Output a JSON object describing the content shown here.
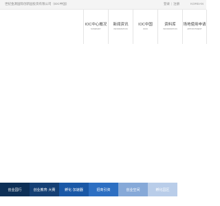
{
  "header": {
    "site_title": "世纪金源国际创新园投资有限公司（IDC中国）",
    "links": [
      "登录",
      "注册"
    ],
    "lang": "KOREAN"
  },
  "nav": [
    {
      "cn": "IOC中心概况",
      "en": "SUMMARY"
    },
    {
      "cn": "新闻资讯",
      "en": "INFORMATION"
    },
    {
      "cn": "IOC中国",
      "en": "IOCK"
    },
    {
      "cn": "资料库",
      "en": "INFORMATION"
    },
    {
      "cn": "场地使用申请",
      "en": "APPOINTMENT"
    }
  ],
  "tabs": [
    {
      "label": "创业园行",
      "color": "#0d2f56"
    },
    {
      "label": "创业教育·大赛",
      "color": "#153f74"
    },
    {
      "label": "孵化·加速器",
      "color": "#1a58a6"
    },
    {
      "label": "招商引资",
      "color": "#2d6fc2"
    },
    {
      "label": "创业空间",
      "color": "#86a9d8"
    },
    {
      "label": "孵化园区",
      "color": "#b9cde9"
    }
  ]
}
